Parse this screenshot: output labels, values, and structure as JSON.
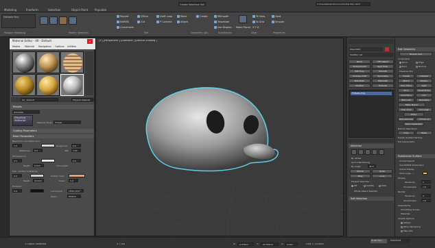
{
  "ribbon": {
    "tabs": [
      "Modeling",
      "Freeform",
      "Selection",
      "Object Paint",
      "Populate"
    ],
    "mode_label": "Editable Poly",
    "groups": [
      "Polygon Modeling",
      "Modify Selection",
      "Edit",
      "Geometry (All)",
      "Subdivision",
      "Align",
      "Properties"
    ],
    "buttons": [
      "Repeat",
      "QSlice",
      "Swift Loop",
      "Relax",
      "Create",
      "MSmooth",
      "To View",
      "Hard",
      "NURMS",
      "Cut",
      "P Connect",
      "Attach",
      "Tessellate",
      "To Grid",
      "Smooth",
      "Constraints",
      "Use Displac..",
      "Make Planar",
      "X Y Z"
    ],
    "selection_set": "Create Selection Set",
    "path": "C:\\Users\\Mesar\\Documents\\3ds Max 2022"
  },
  "material_editor": {
    "title": "Material Editor - 09 - Default",
    "menu": [
      "Modes",
      "Material",
      "Navigation",
      "Options",
      "Utilities"
    ],
    "material_name": "09 - Default",
    "material_type": "Physical Material",
    "presets_label": "Presets",
    "presets_value": "(Finishes)",
    "material_mode_label": "Material Mode:",
    "material_mode_value": "Simple",
    "logo_text": "Physical Material",
    "coating_label": "Coating Parameters",
    "basic_label": "Basic Parameters",
    "base_color_label": "Base Color and Reflections",
    "base_val": "1.0",
    "roughness_label": "Roughness",
    "roughness_val": "0.0",
    "metalness_label": "Metalness:",
    "metalness_val": "0.0",
    "ior_label": "IOR:",
    "ior_val": "1.52",
    "transparency_label": "Transparency",
    "transp_val": "0.0",
    "transp_rough": "0.0",
    "depth_label": "Depth:",
    "depth_val": "0.0cm",
    "thin_label": "Thin-walled",
    "sss_label": "Sub - Surface Scattering",
    "sss_val": "0.0",
    "scatter_label": "Scatter Color:",
    "depth2_val": "10.0cm",
    "scale_label": "Scale:",
    "scale_val": "1.0",
    "emission_label": "Emission",
    "emission_val": "0.0",
    "luminance_label": "Luminance:",
    "luminance_val": "1500 cd/m²",
    "kelvin_label": "Kelvin:",
    "kelvin_val": "6500.0",
    "scatter_color": "#f0a070"
  },
  "viewport": {
    "label": "[+] [Perspective ] [Standard ] [Default Shading ]"
  },
  "command_panel": {
    "object_name": "Object001",
    "modifier_list": "Modifier List",
    "buttons": [
      "Bend",
      "FFD Select",
      "Turbosmooth",
      "Open Edg..",
      "Edit Poly",
      "Smooth",
      "Unwrap UVW",
      "Symmetry",
      "Edit Mesh",
      "MSmooth",
      "ShellSel",
      "Extrude"
    ],
    "stack_item": "Editable Poly",
    "selection_label": "Selection",
    "by_vertex": "By Vertex",
    "ignore_backfacing": "Ignore Backfacing",
    "angle_label": "By Angle",
    "angle_val": "45.0",
    "shrink": "Shrink",
    "grow": "Grow",
    "ring": "Ring",
    "loop": "Loop",
    "preview_label": "Preview Selection",
    "preview_off": "Off",
    "preview_subobj": "SubObj",
    "preview_multi": "Multi",
    "whole_object": "Whole Object Selected",
    "soft_selection": "Soft Selection"
  },
  "edit_panel": {
    "edit_geometry": "Edit Geometry",
    "repeat_last": "Repeat Last",
    "constraints": "Constraints",
    "c_none": "None",
    "c_edge": "Edge",
    "c_face": "Face",
    "c_normal": "Normal",
    "preserve_uvs": "Preserve UVs",
    "create": "Create",
    "collapse": "Collapse",
    "attach": "Attach",
    "detach": "Detach",
    "slice_plane": "Slice Plane",
    "split": "Split",
    "slice": "Slice",
    "reset_plane": "Reset Plane",
    "quickslice": "QuickSlice",
    "cut": "Cut",
    "msmooth": "MSmooth",
    "tessellate": "Tessellate",
    "make_planar": "Make Planar",
    "view_align": "View Align",
    "grid_align": "Grid Align",
    "relax": "Relax",
    "hide_selected": "Hide Selected",
    "unhide_all": "Unhide All",
    "hide_unselected": "Hide Unselected",
    "named_selections": "Named Selections:",
    "copy": "Copy",
    "paste": "Paste",
    "delete_isolated": "Delete Isolated Vertices",
    "full_interactivity": "Full Interactivity",
    "subdivision_surface": "Subdivision Surface",
    "smooth_result": "Smooth Result",
    "use_nurms": "Use NURMS Subdivision",
    "isoline": "Isoline Display",
    "show_cage": "Show Cage......",
    "display": "Display",
    "iterations_label": "Iterations:",
    "iterations_val": "1",
    "smoothness_label": "Smoothness:",
    "smoothness_val": "1.0",
    "render": "Render",
    "r_iterations_val": "0",
    "r_smoothness_val": "1.0",
    "separate_by": "Separate By",
    "smoothing_groups": "Smoothing Groups",
    "materials": "Materials",
    "update_options": "Update Options",
    "always": "Always",
    "when_rendering": "When Rendering",
    "manually": "Manually",
    "cage_color": "#f0d000"
  },
  "status": {
    "selection": "1 Object Selected",
    "frame": "0 / 100",
    "x_label": "X:",
    "x_val": "-4.378cm",
    "y_label": "Y:",
    "y_val": "-31.554cm",
    "z_label": "Z:",
    "z_val": "0.0cm",
    "grid": "Grid = 10.0cm",
    "autokey": "Auto Key",
    "selected": "Selected"
  }
}
